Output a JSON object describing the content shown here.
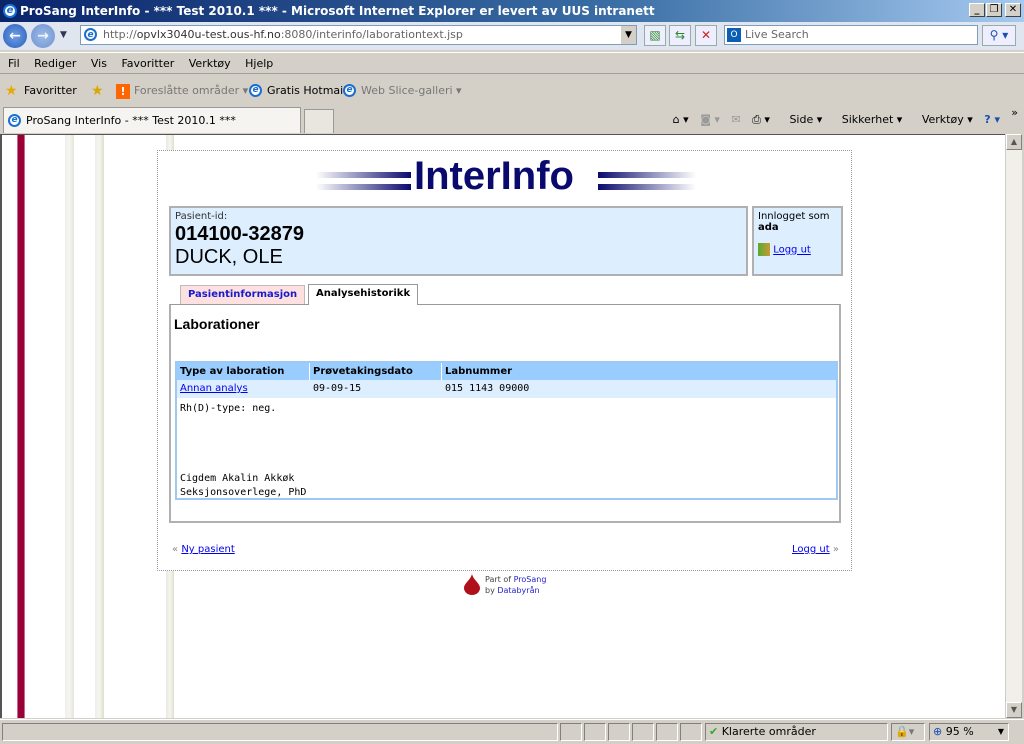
{
  "window": {
    "title": "ProSang InterInfo - *** Test 2010.1 *** - Microsoft Internet Explorer er levert av UUS intranett",
    "minimize": "_",
    "restore": "❐",
    "close": "✕"
  },
  "address": {
    "prefix": "http://",
    "host": "opvlx3040u-test.ous-hf.no",
    "rest": ":8080/interinfo/laborationtext.jsp"
  },
  "search": {
    "placeholder": "Live Search"
  },
  "menu": [
    "Fil",
    "Rediger",
    "Vis",
    "Favoritter",
    "Verktøy",
    "Hjelp"
  ],
  "favorites": {
    "label": "Favoritter",
    "items": [
      "Foreslåtte områder",
      "Gratis Hotmail",
      "Web Slice-galleri"
    ]
  },
  "tab": {
    "label": "ProSang InterInfo - *** Test 2010.1 ***"
  },
  "commands": [
    "Side",
    "Sikkerhet",
    "Verktøy"
  ],
  "page": {
    "logo": "InterInfo",
    "patient": {
      "label": "Pasient-id:",
      "id": "014100-32879",
      "name": "DUCK, OLE"
    },
    "login": {
      "label": "Innlogget som",
      "user": "ada",
      "logout": "Logg ut"
    },
    "tabs": [
      {
        "label": "Pasientinformasjon",
        "active": false
      },
      {
        "label": "Analysehistorikk",
        "active": true
      }
    ],
    "heading": "Laborationer",
    "table": {
      "headers": [
        "Type av laboration",
        "Prøvetakingsdato",
        "Labnummer"
      ],
      "rows": [
        {
          "type": "Annan analys",
          "date": "09-09-15",
          "labnr": "015 1143 09000"
        }
      ],
      "text": [
        "Rh(D)-type: neg.",
        "Cigdem Akalin Akkøk",
        "Seksjonsoverlege, PhD"
      ]
    },
    "footer": {
      "new_patient": "Ny pasient",
      "logout": "Logg ut",
      "left_marker": "«",
      "right_marker": "»"
    },
    "credit": {
      "part_of": "Part of",
      "prosang": "ProSang",
      "by": "by",
      "databyran": "Databyrån"
    }
  },
  "statusbar": {
    "zone": "Klarerte områder",
    "zoom": "95 %"
  },
  "colors": {
    "accent_red": "#990033",
    "link": "#0000ee",
    "table_header": "#99ccff",
    "panel_bg": "#ddeefe",
    "logo": "#0a0a6e"
  }
}
